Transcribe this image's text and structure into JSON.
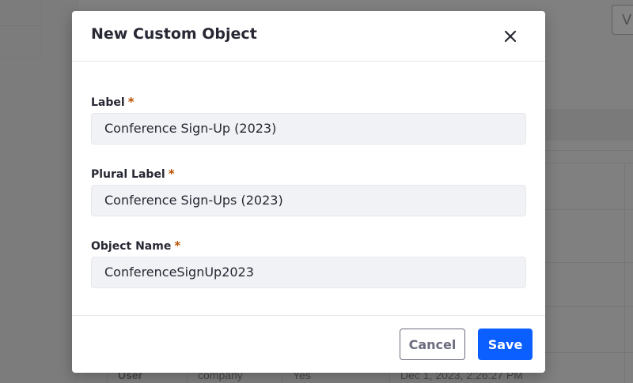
{
  "background": {
    "view_button_label": "V",
    "bottom_row": {
      "cell1": "User",
      "cell2": "company",
      "cell3": "Yes",
      "cell4": "Dec 1, 2023, 2:26:27 PM"
    }
  },
  "modal": {
    "title": "New Custom Object",
    "close_icon": "close-icon",
    "fields": [
      {
        "label": "Label",
        "required_mark": "*",
        "value": "Conference Sign-Up (2023)"
      },
      {
        "label": "Plural Label",
        "required_mark": "*",
        "value": "Conference Sign-Ups (2023)"
      },
      {
        "label": "Object Name",
        "required_mark": "*",
        "value": "ConferenceSignUp2023"
      }
    ],
    "footer": {
      "cancel_label": "Cancel",
      "save_label": "Save"
    }
  },
  "colors": {
    "primary": "#0b5fff",
    "required": "#b95000",
    "overlay": "#808081"
  }
}
